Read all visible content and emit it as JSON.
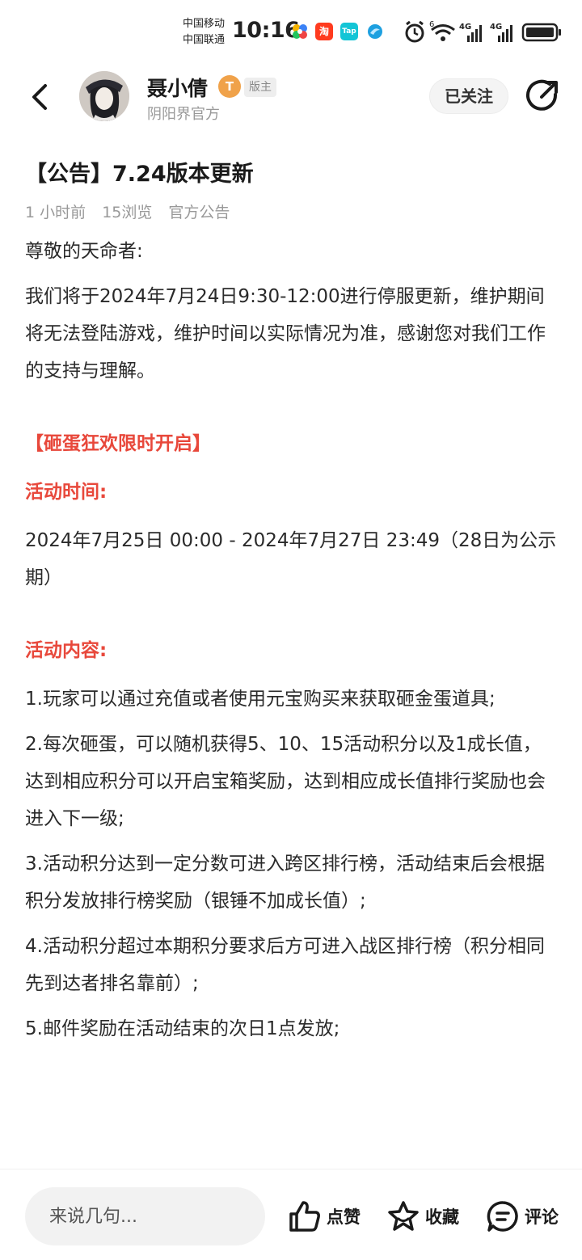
{
  "status_bar": {
    "carrier_1": "中国移动",
    "carrier_2": "中国联通",
    "time": "10:16",
    "app_icons": [
      "pinwheel-icon",
      "taobao-icon",
      "taptap-icon",
      "browser-icon"
    ],
    "taobao_label": "淘",
    "taptap_label": "Tap",
    "system_icons": [
      "alarm-icon",
      "wifi-icon",
      "signal-4g-icon",
      "signal-4g-icon",
      "battery-icon"
    ],
    "wifi_tag": "6",
    "network_1": "4G",
    "network_2": "4G"
  },
  "header": {
    "author_name": "聂小倩",
    "author_badge": "T",
    "mod_tag": "版主",
    "author_subtitle": "阴阳界官方",
    "follow_label": "已关注"
  },
  "article": {
    "title": "【公告】7.24版本更新",
    "meta": {
      "time_ago": "1 小时前",
      "views": "15浏览",
      "category": "官方公告"
    },
    "greeting": "尊敬的天命者:",
    "intro": "我们将于2024年7月24日9:30-12:00进行停服更新，维护期间将无法登陆游戏，维护时间以实际情况为准，感谢您对我们工作的支持与理解。",
    "event_title": "【砸蛋狂欢限时开启】",
    "time_heading": "活动时间:",
    "time_text": "2024年7月25日 00:00 - 2024年7月27日 23:49（28日为公示期）",
    "content_heading": "活动内容:",
    "rules": [
      "1.玩家可以通过充值或者使用元宝购买来获取砸金蛋道具;",
      "2.每次砸蛋，可以随机获得5、10、15活动积分以及1成长值，达到相应积分可以开启宝箱奖励，达到相应成长值排行奖励也会进入下一级;",
      "3.活动积分达到一定分数可进入跨区排行榜，活动结束后会根据积分发放排行榜奖励（银锤不加成长值）;",
      "4.活动积分超过本期积分要求后方可进入战区排行榜（积分相同先到达者排名靠前）;",
      "5.邮件奖励在活动结束的次日1点发放;"
    ]
  },
  "bottom_bar": {
    "comment_placeholder": "来说几句...",
    "like_label": "点赞",
    "favorite_label": "收藏",
    "comment_label": "评论"
  },
  "colors": {
    "accent_red": "#e8483b",
    "badge_orange": "#f0a24a",
    "muted_text": "#999999"
  }
}
